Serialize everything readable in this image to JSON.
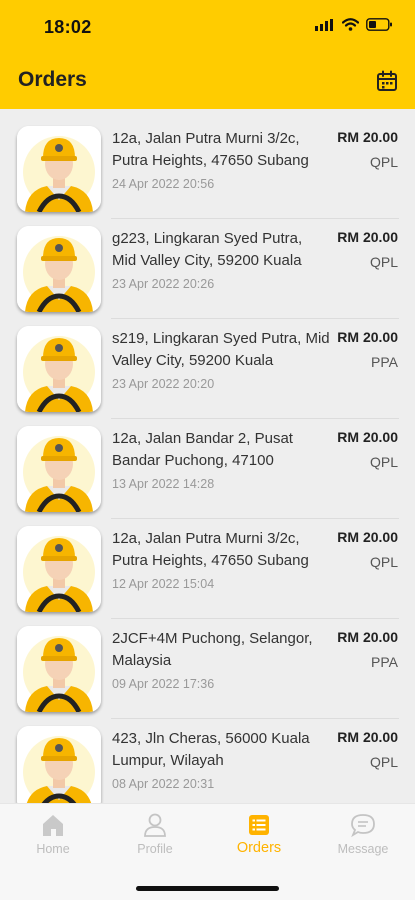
{
  "status": {
    "time": "18:02"
  },
  "header": {
    "title": "Orders"
  },
  "orders": [
    {
      "address": "12a, Jalan Putra Murni 3/2c, Putra Heights, 47650 Subang",
      "date": "24 Apr 2022 20:56",
      "price": "RM 20.00",
      "code": "QPL"
    },
    {
      "address": "g223, Lingkaran Syed Putra, Mid Valley City, 59200 Kuala",
      "date": "23 Apr 2022 20:26",
      "price": "RM 20.00",
      "code": "QPL"
    },
    {
      "address": "s219, Lingkaran Syed Putra, Mid Valley City, 59200 Kuala",
      "date": "23 Apr 2022 20:20",
      "price": "RM 20.00",
      "code": "PPA"
    },
    {
      "address": "12a, Jalan Bandar 2, Pusat Bandar Puchong, 47100",
      "date": "13 Apr 2022 14:28",
      "price": "RM 20.00",
      "code": "QPL"
    },
    {
      "address": "12a, Jalan Putra Murni 3/2c, Putra Heights, 47650 Subang",
      "date": "12 Apr 2022 15:04",
      "price": "RM 20.00",
      "code": "QPL"
    },
    {
      "address": "2JCF+4M Puchong, Selangor, Malaysia",
      "date": "09 Apr 2022 17:36",
      "price": "RM 20.00",
      "code": "PPA"
    },
    {
      "address": "423, Jln Cheras, 56000 Kuala Lumpur, Wilayah",
      "date": "08 Apr 2022 20:31",
      "price": "RM 20.00",
      "code": "QPL"
    }
  ],
  "tabs": {
    "home": "Home",
    "profile": "Profile",
    "orders": "Orders",
    "message": "Message"
  },
  "colors": {
    "accent": "#ffcc00",
    "active_tab": "#ffb300",
    "inactive_tab": "#bdbdbd"
  },
  "icons": {
    "calendar": "calendar-icon",
    "home": "home-icon",
    "profile": "person-icon",
    "orders": "list-icon",
    "message": "chat-bubble-icon"
  }
}
